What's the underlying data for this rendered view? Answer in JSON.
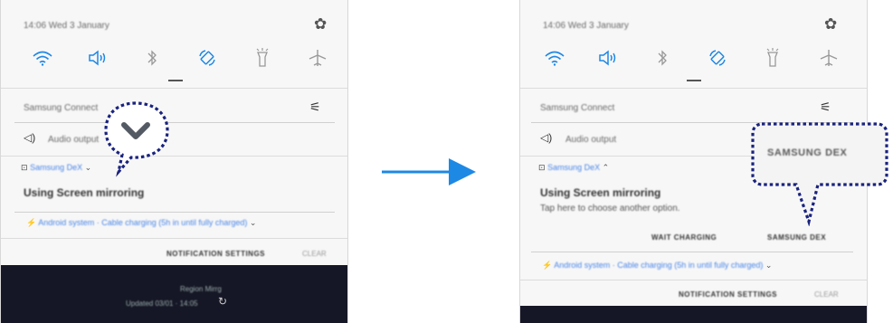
{
  "left": {
    "status_time": "14:06  Wed 3 January",
    "samsung_connect": "Samsung Connect",
    "audio_output": "Audio output",
    "app_label": "Samsung DeX",
    "main_text": "Using Screen mirroring",
    "android_row": "Android system · Cable charging (5h in until fully charged)",
    "notification_settings": "NOTIFICATION SETTINGS",
    "clear": "CLEAR",
    "region_text": "Region Mirrg",
    "updated": "Updated 03/01 · 14:05"
  },
  "right": {
    "status_time": "14:06  Wed 3 January",
    "samsung_connect": "Samsung Connect",
    "audio_output": "Audio output",
    "app_label": "Samsung DeX",
    "main_text": "Using Screen mirroring",
    "sub_text": "Tap here to choose another option.",
    "wait_charging": "WAIT CHARGING",
    "samsung_dex_btn": "SAMSUNG DEX",
    "callout_label": "SAMSUNG DEX",
    "android_row": "Android system · Cable charging (5h in until fully charged)",
    "notification_settings": "NOTIFICATION SETTINGS",
    "clear": "CLEAR"
  },
  "icons": {
    "quick_settings": [
      "wifi-icon",
      "sound-icon",
      "bluetooth-icon",
      "auto-rotate-icon",
      "flashlight-icon",
      "airplane-mode-icon"
    ],
    "settings": "gear-icon",
    "expand": "chevron-down-icon",
    "arrow": "right-arrow-icon"
  },
  "colors": {
    "accent": "#1e88e5",
    "callout_border": "#1a237e",
    "dark_footer": "#161726",
    "panel_bg": "#f7f7f7"
  }
}
